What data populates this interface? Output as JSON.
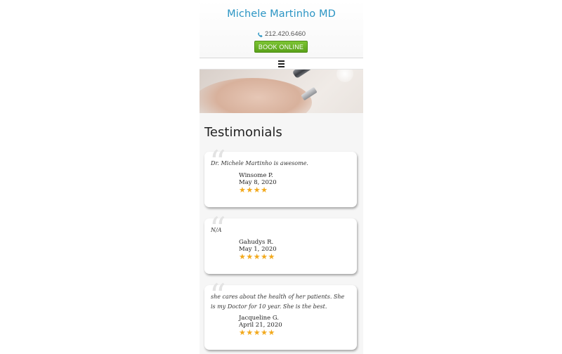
{
  "header": {
    "title": "Michele Martinho MD",
    "phone": "212.420.6460",
    "phone_icon": "phone-icon",
    "book_label": "BOOK ONLINE",
    "accent_color": "#2b95c4",
    "button_color": "#6ab226"
  },
  "nav": {
    "menu_icon": "hamburger-menu-icon"
  },
  "page": {
    "section_title": "Testimonials"
  },
  "testimonials": [
    {
      "quote": "Dr. Michele Martinho is awesome.",
      "name": "Winsome P.",
      "date": "May 8, 2020",
      "stars": "★★★★",
      "rating": 4
    },
    {
      "quote": "N/A",
      "name": "Gahudys R.",
      "date": "May 1, 2020",
      "stars": "★★★★★",
      "rating": 5
    },
    {
      "quote": "she cares about the health of her patients. She is my Doctor for 10 year. She is the best.",
      "name": "Jacqueline G.",
      "date": "April 21, 2020",
      "stars": "★★★★★",
      "rating": 5
    }
  ]
}
